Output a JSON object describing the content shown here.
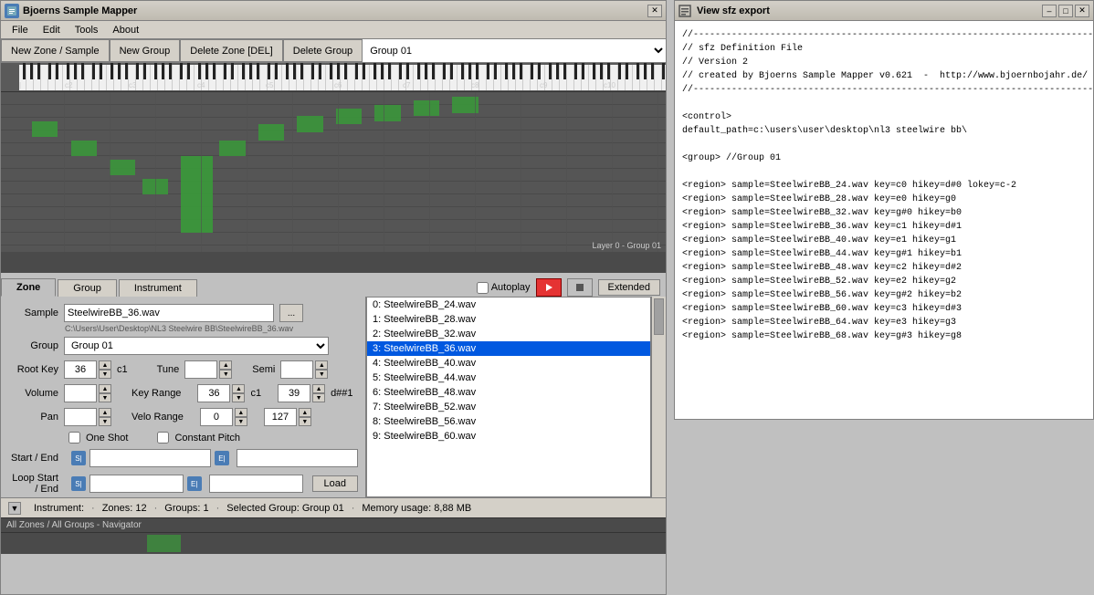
{
  "app": {
    "title": "Bjoerns Sample Mapper",
    "sfz_title": "View sfz export"
  },
  "menu": {
    "items": [
      "File",
      "Edit",
      "Tools",
      "About"
    ]
  },
  "toolbar": {
    "new_zone_label": "New Zone / Sample",
    "new_group_label": "New Group",
    "delete_zone_label": "Delete Zone [DEL]",
    "delete_group_label": "Delete Group",
    "group_select_value": "Group 01"
  },
  "tabs": {
    "zone_label": "Zone",
    "group_label": "Group",
    "instrument_label": "Instrument",
    "autoplay_label": "Autoplay",
    "extended_label": "Extended"
  },
  "zone_props": {
    "sample_label": "Sample",
    "sample_value": "SteelwireBB_36.wav",
    "sample_path": "C:\\Users\\User\\Desktop\\NL3 Steelwire BB\\SteelwireBB_36.wav",
    "browse_label": "...",
    "group_label": "Group",
    "group_value": "Group 01",
    "root_key_label": "Root Key",
    "root_key_value": "36",
    "root_key_note": "c1",
    "tune_label": "Tune",
    "tune_value": "",
    "semi_label": "Semi",
    "semi_value": "",
    "volume_label": "Volume",
    "volume_value": "",
    "key_range_label": "Key Range",
    "key_range_from": "36",
    "key_range_from_note": "c1",
    "key_range_to": "39",
    "key_range_to_note": "d##1",
    "pan_label": "Pan",
    "pan_value": "",
    "velo_range_label": "Velo Range",
    "velo_from": "0",
    "velo_to": "127",
    "one_shot_label": "One Shot",
    "constant_pitch_label": "Constant Pitch",
    "start_end_label": "Start / End",
    "loop_start_end_label": "Loop Start / End",
    "load_label": "Load"
  },
  "sample_list": {
    "items": [
      {
        "index": 0,
        "label": "0: SteelwireBB_24.wav",
        "selected": false
      },
      {
        "index": 1,
        "label": "1: SteelwireBB_28.wav",
        "selected": false
      },
      {
        "index": 2,
        "label": "2: SteelwireBB_32.wav",
        "selected": false
      },
      {
        "index": 3,
        "label": "3: SteelwireBB_36.wav",
        "selected": true
      },
      {
        "index": 4,
        "label": "4: SteelwireBB_40.wav",
        "selected": false
      },
      {
        "index": 5,
        "label": "5: SteelwireBB_44.wav",
        "selected": false
      },
      {
        "index": 6,
        "label": "6: SteelwireBB_48.wav",
        "selected": false
      },
      {
        "index": 7,
        "label": "7: SteelwireBB_52.wav",
        "selected": false
      },
      {
        "index": 8,
        "label": "8: SteelwireBB_56.wav",
        "selected": false
      },
      {
        "index": 9,
        "label": "9: SteelwireBB_60.wav",
        "selected": false
      }
    ]
  },
  "status_bar": {
    "instrument_label": "Instrument:",
    "zones_label": "Zones: 12",
    "groups_label": "Groups: 1",
    "selected_group_label": "Selected Group: Group 01",
    "memory_label": "Memory usage: 8,88 MB"
  },
  "navigator": {
    "label": "All Zones / All Groups - Navigator"
  },
  "sfz_content": "//--------------------------------------------------------------------------------------------------------------\n// sfz Definition File\n// Version 2\n// created by Bjoerns Sample Mapper v0.621  -  http://www.bjoernbojahr.de/\n//--------------------------------------------------------------------------------------------------------------\n\n<control>\ndefault_path=c:\\users\\user\\desktop\\nl3 steelwire bb\\\n\n<group> //Group 01\n\n<region> sample=SteelwireBB_24.wav key=c0 hikey=d#0 lokey=c-2\n<region> sample=SteelwireBB_28.wav key=e0 hikey=g0\n<region> sample=SteelwireBB_32.wav key=g#0 hikey=b0\n<region> sample=SteelwireBB_36.wav key=c1 hikey=d#1\n<region> sample=SteelwireBB_40.wav key=e1 hikey=g1\n<region> sample=SteelwireBB_44.wav key=g#1 hikey=b1\n<region> sample=SteelwireBB_48.wav key=c2 hikey=d#2\n<region> sample=SteelwireBB_52.wav key=e2 hikey=g2\n<region> sample=SteelwireBB_56.wav key=g#2 hikey=b2\n<region> sample=SteelwireBB_60.wav key=c3 hikey=d#3\n<region> sample=SteelwireBB_64.wav key=e3 hikey=g3\n<region> sample=SteelwireBB_68.wav key=g#3 hikey=g8"
}
